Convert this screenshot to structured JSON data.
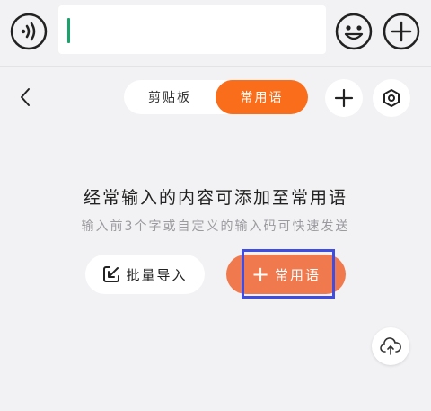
{
  "toolbar": {
    "voice_icon": "voice-wave-icon",
    "input_value": "",
    "emoji_icon": "smiley-icon",
    "plus_icon": "plus-circle-icon"
  },
  "header": {
    "back_icon": "chevron-left-icon",
    "tabs": [
      {
        "label": "剪贴板",
        "active": false
      },
      {
        "label": "常用语",
        "active": true
      }
    ],
    "add_icon": "plus-icon",
    "settings_icon": "hexagon-settings-icon"
  },
  "empty_state": {
    "title": "经常输入的内容可添加至常用语",
    "subtitle": "输入前3个字或自定义的输入码可快速发送"
  },
  "actions": {
    "batch_import_label": "批量导入",
    "add_phrase_label": "常用语",
    "add_phrase_plus": "+"
  },
  "cloud_icon": "cloud-upload-icon",
  "colors": {
    "accent": "#fa6d1a",
    "button_orange": "#f07a4e",
    "highlight": "#3f4ee0",
    "cursor": "#1aa36b"
  }
}
